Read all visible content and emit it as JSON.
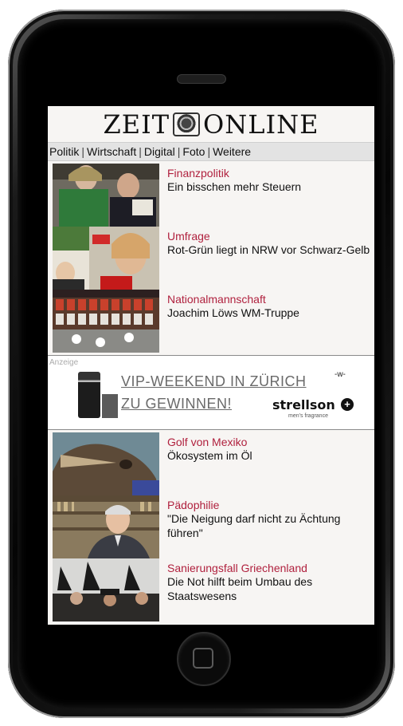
{
  "logo": {
    "left": "ZEIT",
    "right": "ONLINE"
  },
  "nav": [
    "Politik",
    "Wirtschaft",
    "Digital",
    "Foto",
    "Weitere"
  ],
  "nav_separator": "|",
  "articles_top": [
    {
      "kicker": "Finanzpolitik",
      "headline": "Ein bisschen mehr Steuern"
    },
    {
      "kicker": "Umfrage",
      "headline": "Rot-Grün liegt in NRW vor Schwarz-Gelb"
    },
    {
      "kicker": "Nationalmannschaft",
      "headline": "Joachim Löws WM-Truppe"
    }
  ],
  "ad": {
    "label": "Anzeige",
    "line1": "VIP-WEEKEND IN ZÜRICH",
    "line2": "ZU GEWINNEN!",
    "brand": "strellson",
    "brand_sub": "men's fragrance",
    "mark": "-w-"
  },
  "articles_bottom": [
    {
      "kicker": "Golf von Mexiko",
      "headline": "Ökosystem im Öl"
    },
    {
      "kicker": "Pädophilie",
      "headline": "\"Die Neigung darf nicht zu Ächtung führen\""
    },
    {
      "kicker": "Sanierungsfall Griechenland",
      "headline": "Die Not hilft beim Umbau des Staatswesens"
    }
  ],
  "colors": {
    "kicker": "#b0213e",
    "nav_bg": "#e3e3e3"
  },
  "icons": {
    "logo_emblem": "eagle-crest-icon",
    "home": "home-button-icon"
  }
}
